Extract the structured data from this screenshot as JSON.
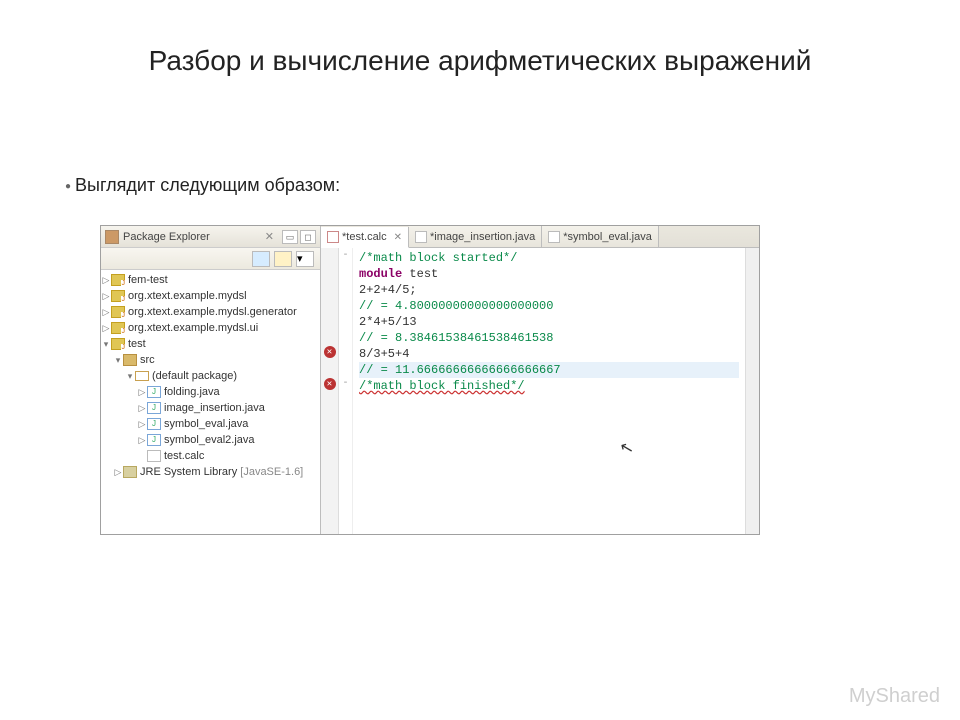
{
  "slide": {
    "title": "Разбор и вычисление арифметических выражений",
    "subtitle": "Выглядит следующим образом:"
  },
  "package_explorer": {
    "title": "Package Explorer",
    "projects": [
      {
        "name": "fem-test"
      },
      {
        "name": "org.xtext.example.mydsl"
      },
      {
        "name": "org.xtext.example.mydsl.generator"
      },
      {
        "name": "org.xtext.example.mydsl.ui"
      },
      {
        "name": "test",
        "expanded": true
      }
    ],
    "src_folder": "src",
    "default_package": "(default package)",
    "files": [
      "folding.java",
      "image_insertion.java",
      "symbol_eval.java",
      "symbol_eval2.java",
      "test.calc"
    ],
    "library": "JRE System Library",
    "library_suffix": "[JavaSE-1.6]"
  },
  "tabs": [
    {
      "label": "*test.calc",
      "active": true
    },
    {
      "label": "*image_insertion.java",
      "active": false
    },
    {
      "label": "*symbol_eval.java",
      "active": false
    }
  ],
  "code": {
    "lines": [
      {
        "text": "/*math block started*/",
        "cls": "cm"
      },
      {
        "kw": "module",
        "rest": " test"
      },
      {
        "text": "2+2+4/5;"
      },
      {
        "text": "// = 4.80000000000000000000",
        "cls": "cm"
      },
      {
        "text": "2*4+5/13"
      },
      {
        "text": "// = 8.38461538461538461538",
        "cls": "cm"
      },
      {
        "text": "8/3+5+4"
      },
      {
        "text": "// = 11.66666666666666666667",
        "cls": "cm",
        "hl": true
      },
      {
        "text": "/*math block finished*/",
        "cls": "cm",
        "wavy": true
      }
    ]
  },
  "watermark": "MyShared"
}
